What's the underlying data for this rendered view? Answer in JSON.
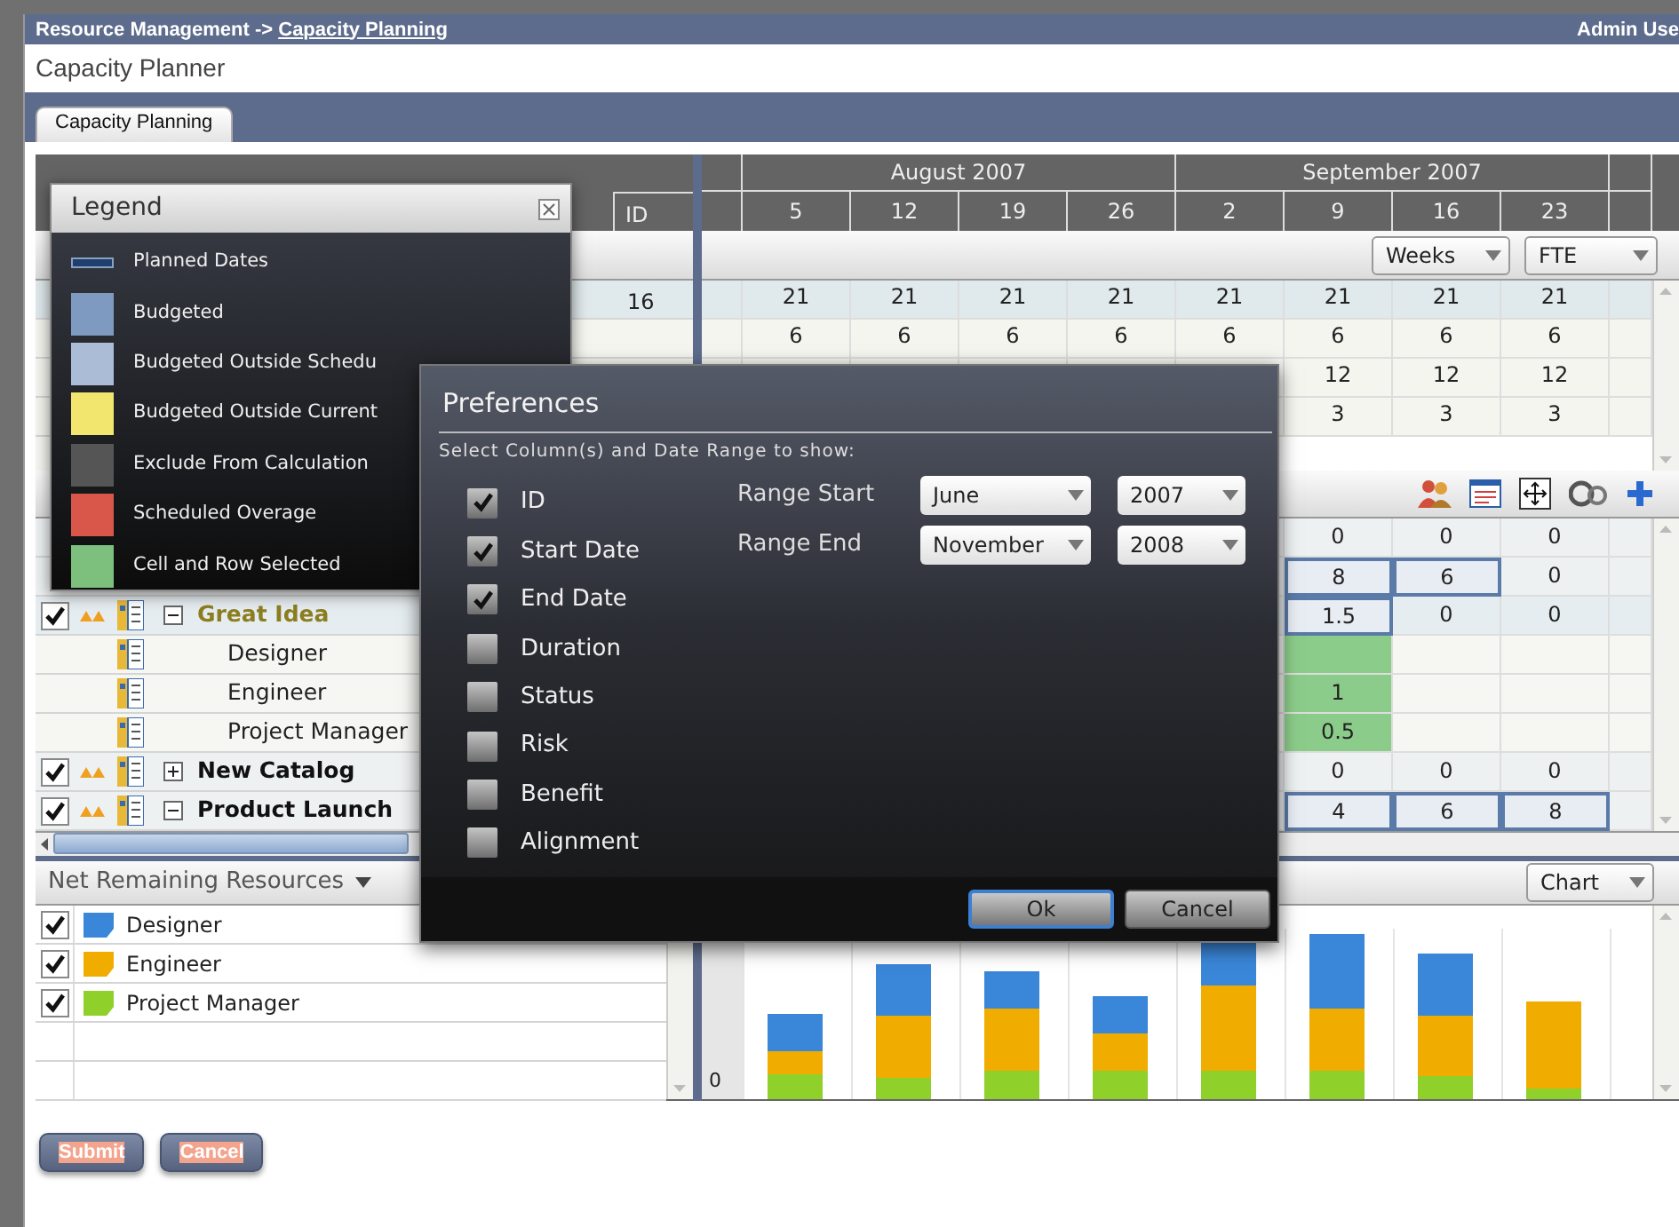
{
  "header": {
    "crumb": "Resource Management -> ",
    "crumb_link": "Capacity Planning",
    "user": "Admin Use"
  },
  "page_title": "Capacity Planner",
  "tabs": [
    {
      "label": "Capacity Planning",
      "selected": true
    }
  ],
  "grid": {
    "id_column": "ID",
    "months": [
      {
        "label": "August 2007",
        "weeks": [
          "5",
          "12",
          "19",
          "26"
        ]
      },
      {
        "label": "September 2007",
        "weeks": [
          "2",
          "9",
          "16",
          "23"
        ]
      }
    ]
  },
  "resources_toolbar": {
    "period": "Weeks",
    "unit": "FTE"
  },
  "resource_rows": [
    {
      "id": "16",
      "highlighted": true,
      "cells": [
        "21",
        "21",
        "21",
        "21",
        "21",
        "21",
        "21",
        "21"
      ]
    },
    {
      "highlighted": false,
      "cells": [
        "6",
        "6",
        "6",
        "6",
        "6",
        "6",
        "6",
        "6"
      ]
    },
    {
      "highlighted": false,
      "cells": [
        "12",
        "12",
        "12"
      ]
    },
    {
      "highlighted": false,
      "cells": [
        "3",
        "3",
        "3"
      ]
    }
  ],
  "projects": [
    {
      "kind": "project",
      "cells": [
        {
          "text": "0",
          "kind": "plain"
        },
        {
          "text": "0",
          "kind": "plain"
        },
        {
          "text": "0",
          "kind": "plain"
        }
      ]
    },
    {
      "kind": "project",
      "cells": [
        {
          "text": "8",
          "kind": "planned"
        },
        {
          "text": "6",
          "kind": "planned"
        },
        {
          "text": "0",
          "kind": "plain"
        }
      ]
    },
    {
      "kind": "project",
      "name": "Great Idea",
      "checked": true,
      "expanded": true,
      "selected": true,
      "cells": [
        {
          "text": "1.5",
          "kind": "planned"
        },
        {
          "text": "0",
          "kind": "plain"
        },
        {
          "text": "0",
          "kind": "plain"
        }
      ]
    },
    {
      "kind": "role",
      "name": "Designer",
      "selected": false,
      "cells": [
        {
          "kind": "selected"
        },
        {
          "kind": "plain"
        },
        {
          "kind": "plain"
        }
      ]
    },
    {
      "kind": "role",
      "name": "Engineer",
      "selected": false,
      "cells": [
        {
          "text": "1",
          "kind": "selected"
        },
        {
          "kind": "plain"
        },
        {
          "kind": "plain"
        }
      ]
    },
    {
      "kind": "role",
      "name": "Project Manager",
      "selected": false,
      "cells": [
        {
          "text": "0.5",
          "kind": "selected"
        },
        {
          "kind": "plain"
        },
        {
          "kind": "plain"
        }
      ]
    },
    {
      "kind": "project",
      "name": "New Catalog",
      "checked": true,
      "expanded": false,
      "selected": false,
      "cells": [
        {
          "text": "0",
          "kind": "plain"
        },
        {
          "text": "0",
          "kind": "plain"
        },
        {
          "text": "0",
          "kind": "plain"
        }
      ]
    },
    {
      "kind": "project",
      "name": "Product Launch",
      "checked": true,
      "expanded": true,
      "selected": false,
      "cells": [
        {
          "text": "4",
          "kind": "planned"
        },
        {
          "text": "6",
          "kind": "planned"
        },
        {
          "text": "8",
          "kind": "planned"
        }
      ]
    }
  ],
  "resource_chart": {
    "title": "Net Remaining Resources",
    "view": "Chart",
    "axis_label": "0",
    "series": [
      {
        "name": "Designer",
        "color": "#3a86d8",
        "checked": true
      },
      {
        "name": "Engineer",
        "color": "#f0ad00",
        "checked": true
      },
      {
        "name": "Project Manager",
        "color": "#8fd02a",
        "checked": true
      }
    ]
  },
  "buttons": [
    {
      "label": "Submit"
    },
    {
      "label": "Cancel"
    }
  ],
  "legend": {
    "title": "Legend",
    "items": [
      {
        "label": "Planned Dates",
        "kind": "line",
        "color": "#1f3f6e"
      },
      {
        "label": "Budgeted",
        "kind": "swatch",
        "color": "#7f9ac0"
      },
      {
        "label": "Budgeted Outside Schedu",
        "kind": "swatch",
        "color": "#abbdd6"
      },
      {
        "label": "Budgeted Outside Current",
        "kind": "swatch",
        "color": "#f2e66e"
      },
      {
        "label": "Exclude From Calculation",
        "kind": "swatch",
        "color": "#555555"
      },
      {
        "label": "Scheduled Overage",
        "kind": "swatch",
        "color": "#d9574a"
      },
      {
        "label": "Cell and Row Selected",
        "kind": "swatch",
        "color": "#7dbf7d"
      }
    ]
  },
  "preferences": {
    "title": "Preferences",
    "subtitle": "Select Column(s) and Date Range to show:",
    "columns": [
      {
        "label": "ID",
        "checked": true
      },
      {
        "label": "Start Date",
        "checked": true
      },
      {
        "label": "End Date",
        "checked": true
      },
      {
        "label": "Duration",
        "checked": false
      },
      {
        "label": "Status",
        "checked": false
      },
      {
        "label": "Risk",
        "checked": false
      },
      {
        "label": "Benefit",
        "checked": false
      },
      {
        "label": "Alignment",
        "checked": false
      }
    ],
    "ranges": [
      {
        "label": "Range Start",
        "month": "June",
        "year": "2007"
      },
      {
        "label": "Range End",
        "month": "November",
        "year": "2008"
      }
    ],
    "buttons": [
      {
        "label": "Ok",
        "focused": true
      },
      {
        "label": "Cancel",
        "focused": false
      }
    ]
  }
}
